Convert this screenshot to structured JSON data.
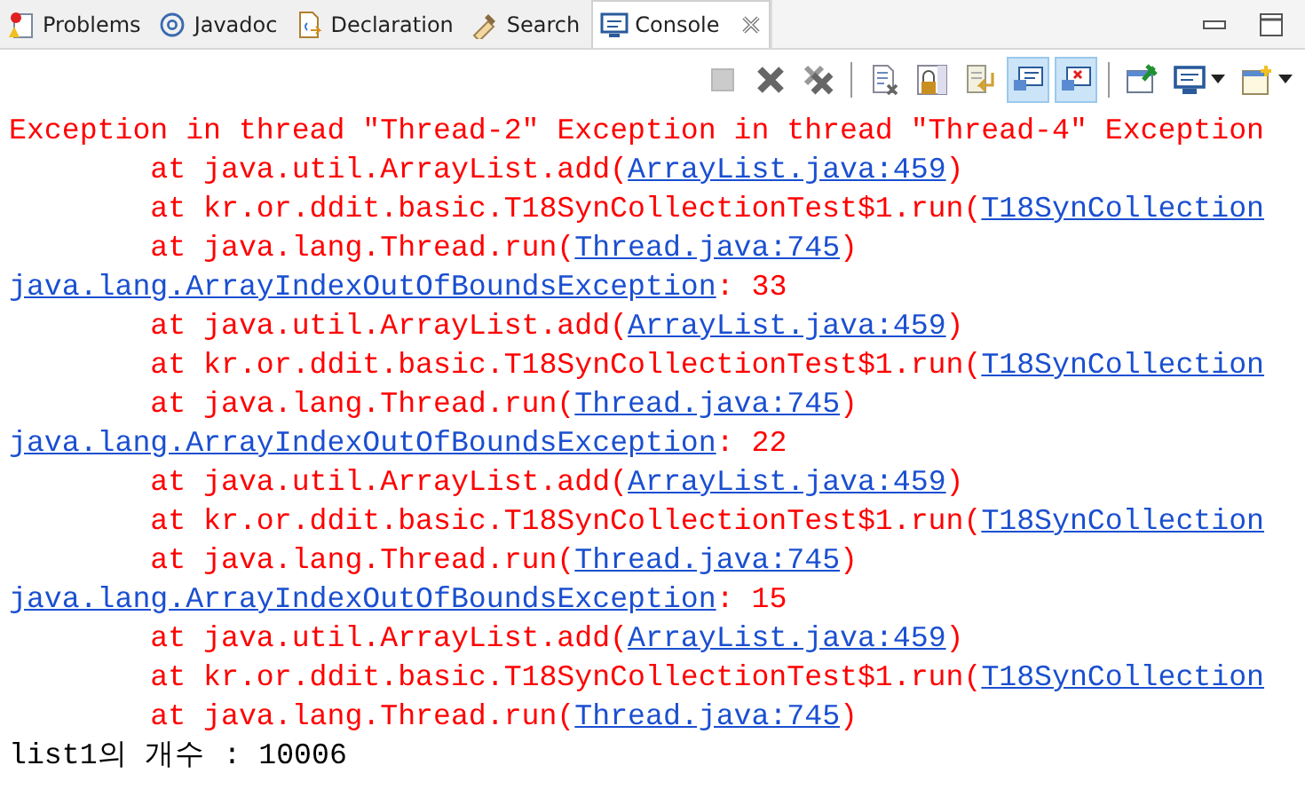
{
  "tabs": [
    {
      "label": "Problems",
      "kind": "problems",
      "selected": false
    },
    {
      "label": "Javadoc",
      "kind": "javadoc",
      "selected": false
    },
    {
      "label": "Declaration",
      "kind": "declaration",
      "selected": false
    },
    {
      "label": "Search",
      "kind": "search",
      "selected": false
    },
    {
      "label": "Console",
      "kind": "console",
      "selected": true
    }
  ],
  "toolbar": [
    {
      "kind": "stop",
      "selected": false,
      "disabled": true
    },
    {
      "kind": "remove",
      "selected": false,
      "disabled": false
    },
    {
      "kind": "remove-all",
      "selected": false,
      "disabled": false
    },
    {
      "kind": "separator"
    },
    {
      "kind": "clear",
      "selected": false,
      "disabled": false
    },
    {
      "kind": "lock",
      "selected": false,
      "disabled": false
    },
    {
      "kind": "wrap",
      "selected": false,
      "disabled": false
    },
    {
      "kind": "show-out",
      "selected": true,
      "disabled": false
    },
    {
      "kind": "show-err",
      "selected": true,
      "disabled": false
    },
    {
      "kind": "separator"
    },
    {
      "kind": "pin",
      "selected": false,
      "disabled": false
    },
    {
      "kind": "display",
      "selected": false,
      "disabled": false,
      "has_menu": true
    },
    {
      "kind": "open",
      "selected": false,
      "disabled": false,
      "has_menu": true
    }
  ],
  "console": [
    {
      "kind": "message",
      "segments": [
        {
          "kind": "error",
          "text": "Exception in thread \"Thread-2\" Exception in thread \"Thread-4\" Exception"
        }
      ]
    },
    {
      "kind": "frame",
      "segments": [
        {
          "kind": "error",
          "text": "at java.util.ArrayList.add("
        },
        {
          "kind": "link",
          "text": "ArrayList.java:459"
        },
        {
          "kind": "error",
          "text": ")"
        }
      ]
    },
    {
      "kind": "frame",
      "segments": [
        {
          "kind": "error",
          "text": "at kr.or.ddit.basic.T18SynCollectionTest$1.run("
        },
        {
          "kind": "link",
          "text": "T18SynCollection"
        }
      ]
    },
    {
      "kind": "frame",
      "segments": [
        {
          "kind": "error",
          "text": "at java.lang.Thread.run("
        },
        {
          "kind": "link",
          "text": "Thread.java:745"
        },
        {
          "kind": "error",
          "text": ")"
        }
      ]
    },
    {
      "kind": "message",
      "segments": [
        {
          "kind": "link",
          "text": "java.lang.ArrayIndexOutOfBoundsException"
        },
        {
          "kind": "error",
          "text": ": 33"
        }
      ]
    },
    {
      "kind": "frame",
      "segments": [
        {
          "kind": "error",
          "text": "at java.util.ArrayList.add("
        },
        {
          "kind": "link",
          "text": "ArrayList.java:459"
        },
        {
          "kind": "error",
          "text": ")"
        }
      ]
    },
    {
      "kind": "frame",
      "segments": [
        {
          "kind": "error",
          "text": "at kr.or.ddit.basic.T18SynCollectionTest$1.run("
        },
        {
          "kind": "link",
          "text": "T18SynCollection"
        }
      ]
    },
    {
      "kind": "frame",
      "segments": [
        {
          "kind": "error",
          "text": "at java.lang.Thread.run("
        },
        {
          "kind": "link",
          "text": "Thread.java:745"
        },
        {
          "kind": "error",
          "text": ")"
        }
      ]
    },
    {
      "kind": "message",
      "segments": [
        {
          "kind": "link",
          "text": "java.lang.ArrayIndexOutOfBoundsException"
        },
        {
          "kind": "error",
          "text": ": 22"
        }
      ]
    },
    {
      "kind": "frame",
      "segments": [
        {
          "kind": "error",
          "text": "at java.util.ArrayList.add("
        },
        {
          "kind": "link",
          "text": "ArrayList.java:459"
        },
        {
          "kind": "error",
          "text": ")"
        }
      ]
    },
    {
      "kind": "frame",
      "segments": [
        {
          "kind": "error",
          "text": "at kr.or.ddit.basic.T18SynCollectionTest$1.run("
        },
        {
          "kind": "link",
          "text": "T18SynCollection"
        }
      ]
    },
    {
      "kind": "frame",
      "segments": [
        {
          "kind": "error",
          "text": "at java.lang.Thread.run("
        },
        {
          "kind": "link",
          "text": "Thread.java:745"
        },
        {
          "kind": "error",
          "text": ")"
        }
      ]
    },
    {
      "kind": "message",
      "segments": [
        {
          "kind": "link",
          "text": "java.lang.ArrayIndexOutOfBoundsException"
        },
        {
          "kind": "error",
          "text": ": 15"
        }
      ]
    },
    {
      "kind": "frame",
      "segments": [
        {
          "kind": "error",
          "text": "at java.util.ArrayList.add("
        },
        {
          "kind": "link",
          "text": "ArrayList.java:459"
        },
        {
          "kind": "error",
          "text": ")"
        }
      ]
    },
    {
      "kind": "frame",
      "segments": [
        {
          "kind": "error",
          "text": "at kr.or.ddit.basic.T18SynCollectionTest$1.run("
        },
        {
          "kind": "link",
          "text": "T18SynCollection"
        }
      ]
    },
    {
      "kind": "frame",
      "segments": [
        {
          "kind": "error",
          "text": "at java.lang.Thread.run("
        },
        {
          "kind": "link",
          "text": "Thread.java:745"
        },
        {
          "kind": "error",
          "text": ")"
        }
      ]
    },
    {
      "kind": "message",
      "segments": [
        {
          "kind": "output",
          "text": "list1의 개수 : 10006"
        }
      ]
    }
  ]
}
